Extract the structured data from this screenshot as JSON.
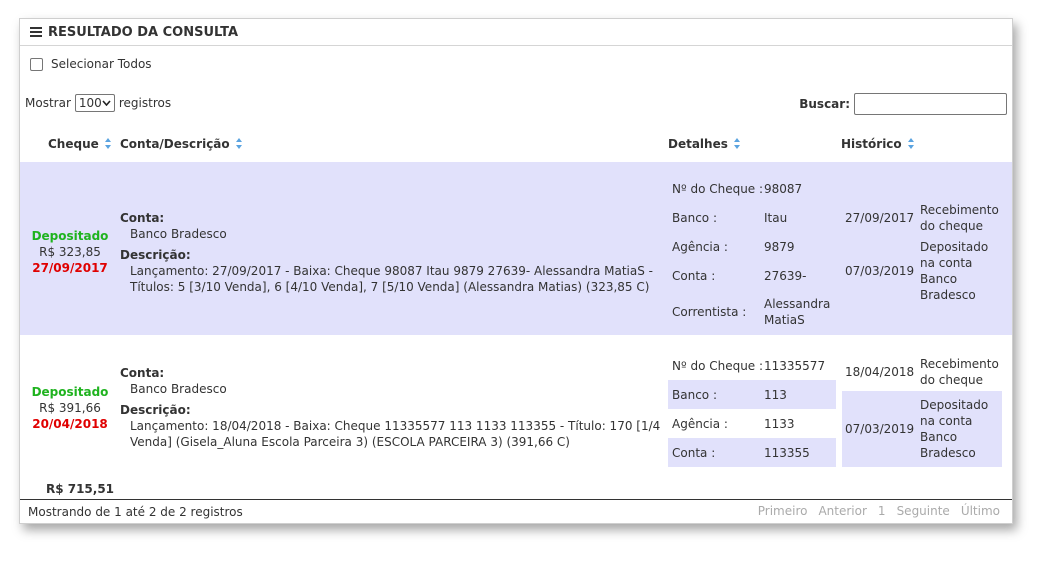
{
  "panel": {
    "title": "RESULTADO DA CONSULTA"
  },
  "select_all": {
    "label": "Selecionar Todos"
  },
  "length": {
    "prefix": "Mostrar",
    "value": "100",
    "suffix": "registros"
  },
  "search": {
    "label": "Buscar:",
    "value": ""
  },
  "columns": {
    "cheque": "Cheque",
    "conta": "Conta/Descrição",
    "detalhes": "Detalhes",
    "historico": "Histórico"
  },
  "rows": [
    {
      "status": "Depositado",
      "valor": "R$ 323,85",
      "data": "27/09/2017",
      "conta_label": "Conta:",
      "conta": "Banco Bradesco",
      "descricao_label": "Descrição:",
      "descricao": "Lançamento: 27/09/2017 - Baixa: Cheque 98087 Itau 9879 27639- Alessandra MatiaS - Títulos: 5 [3/10 Venda], 6 [4/10 Venda], 7 [5/10 Venda] (Alessandra Matias) (323,85 C)",
      "detalhes": [
        {
          "k": "Nº do Cheque :",
          "v": "98087"
        },
        {
          "k": "Banco :",
          "v": "Itau"
        },
        {
          "k": "Agência :",
          "v": "9879"
        },
        {
          "k": "Conta :",
          "v": "27639-"
        },
        {
          "k": "Correntista :",
          "v": "Alessandra MatiaS"
        }
      ],
      "historico": [
        {
          "d": "27/09/2017",
          "t": "Recebimento do cheque"
        },
        {
          "d": "07/03/2019",
          "t": "Depositado na conta Banco Bradesco"
        }
      ]
    },
    {
      "status": "Depositado",
      "valor": "R$ 391,66",
      "data": "20/04/2018",
      "conta_label": "Conta:",
      "conta": "Banco Bradesco",
      "descricao_label": "Descrição:",
      "descricao": "Lançamento: 18/04/2018 - Baixa: Cheque 11335577 113 1133 113355 - Título: 170 [1/4 Venda] (Gisela_Aluna Escola Parceira 3) (ESCOLA PARCEIRA 3) (391,66 C)",
      "detalhes": [
        {
          "k": "Nº do Cheque :",
          "v": "11335577"
        },
        {
          "k": "Banco :",
          "v": "113"
        },
        {
          "k": "Agência :",
          "v": "1133"
        },
        {
          "k": "Conta :",
          "v": "113355"
        }
      ],
      "historico": [
        {
          "d": "18/04/2018",
          "t": "Recebimento do cheque"
        },
        {
          "d": "07/03/2019",
          "t": "Depositado na conta Banco Bradesco"
        }
      ]
    }
  ],
  "total": "R$ 715,51",
  "footer": {
    "info": "Mostrando de 1 até 2 de 2 registros"
  },
  "pager": {
    "first": "Primeiro",
    "prev": "Anterior",
    "page": "1",
    "next": "Seguinte",
    "last": "Último"
  }
}
